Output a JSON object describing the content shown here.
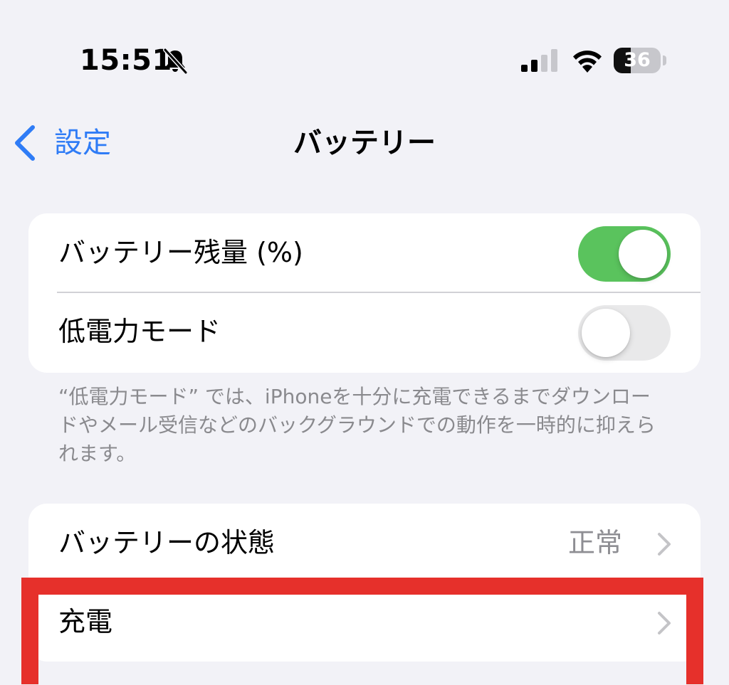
{
  "status_bar": {
    "time": "15:51",
    "battery_level": "36",
    "icons": [
      "bell-slash-icon",
      "signal-icon",
      "wifi-icon",
      "battery-icon"
    ]
  },
  "nav": {
    "back_label": "設定",
    "title": "バッテリー"
  },
  "group1": {
    "battery_percentage": {
      "label": "バッテリー残量 (%)",
      "enabled": true
    },
    "low_power_mode": {
      "label": "低電力モード",
      "enabled": false
    },
    "footer": "“低電力モード” では、iPhoneを十分に充電できるまでダウンロードやメール受信などのバックグラウンドでの動作を一時的に抑えられます。"
  },
  "group2": {
    "battery_health": {
      "label": "バッテリーの状態",
      "value": "正常"
    },
    "charging": {
      "label": "充電"
    }
  },
  "colors": {
    "accent": "#2f7cf6",
    "toggle_on": "#5ac35d",
    "highlight": "#e6302b",
    "background": "#f2f2f7"
  }
}
